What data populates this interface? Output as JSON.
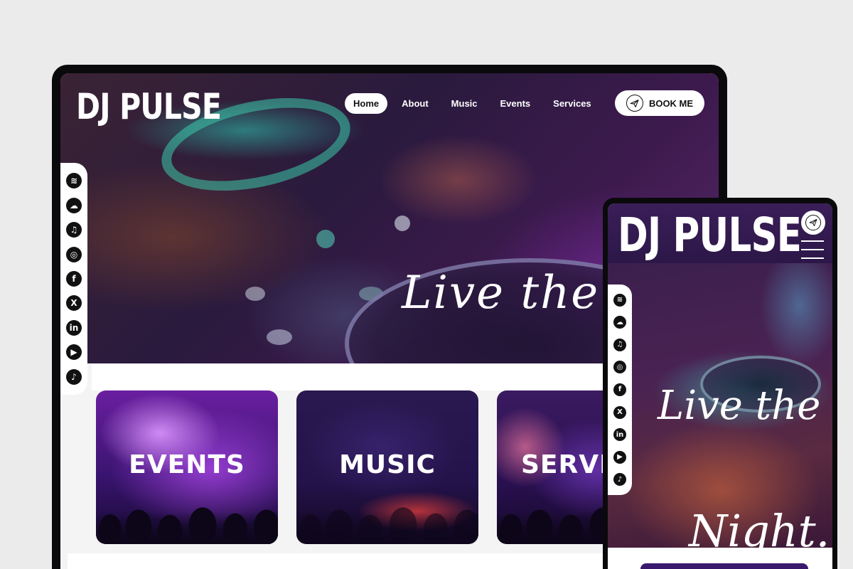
{
  "brand": {
    "name": "DJ PULSE"
  },
  "desktop": {
    "nav": {
      "items": [
        "Home",
        "About",
        "Music",
        "Events",
        "Services"
      ],
      "active": "Home"
    },
    "book_button": {
      "label": "BOOK ME",
      "icon": "paper-plane-icon"
    },
    "hero_text": "Live the N",
    "social": [
      {
        "name": "spotify-icon",
        "glyph": "≋"
      },
      {
        "name": "soundcloud-icon",
        "glyph": "☁"
      },
      {
        "name": "apple-music-icon",
        "glyph": "♫"
      },
      {
        "name": "instagram-icon",
        "glyph": "◎"
      },
      {
        "name": "facebook-icon",
        "glyph": "f"
      },
      {
        "name": "x-icon",
        "glyph": "X"
      },
      {
        "name": "linkedin-icon",
        "glyph": "in"
      },
      {
        "name": "youtube-icon",
        "glyph": "▶"
      },
      {
        "name": "tiktok-icon",
        "glyph": "♪"
      }
    ],
    "cards": [
      {
        "label": "EVENTS"
      },
      {
        "label": "MUSIC"
      },
      {
        "label": "SERVI"
      }
    ]
  },
  "mobile": {
    "hero_line1": "Live the",
    "hero_line2": "Night."
  },
  "colors": {
    "background": "#ebebeb",
    "device": "#0a0a0c",
    "accent": "#6a1fa0"
  }
}
